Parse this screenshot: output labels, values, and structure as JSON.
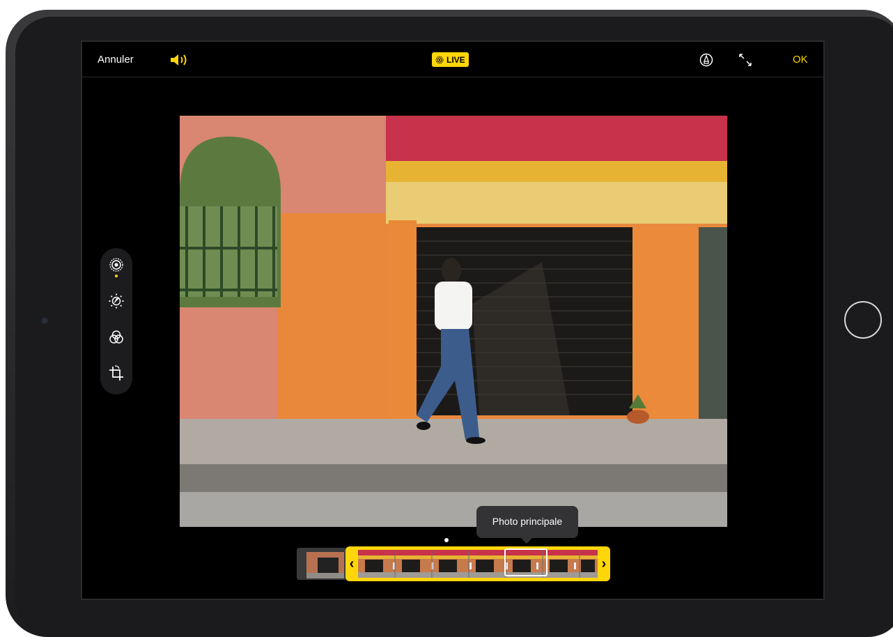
{
  "topbar": {
    "cancel_label": "Annuler",
    "sound_icon": "speaker-icon",
    "live_label": "LIVE",
    "markup_icon": "markup-pen-icon",
    "expand_icon": "expand-arrows-icon",
    "ok_label": "OK"
  },
  "tools": {
    "items": [
      {
        "name": "live-photo-tool",
        "icon": "live-photo-icon",
        "active": true
      },
      {
        "name": "adjust-tool",
        "icon": "adjust-dial-icon"
      },
      {
        "name": "filters-tool",
        "icon": "filters-circles-icon"
      },
      {
        "name": "crop-tool",
        "icon": "crop-rotate-icon"
      }
    ]
  },
  "photo": {
    "description": "edited-photo"
  },
  "keyphoto": {
    "tooltip": "Photo principale"
  },
  "colors": {
    "accent": "#ffd60a",
    "background": "#000000",
    "panel": "#1c1c1e"
  }
}
